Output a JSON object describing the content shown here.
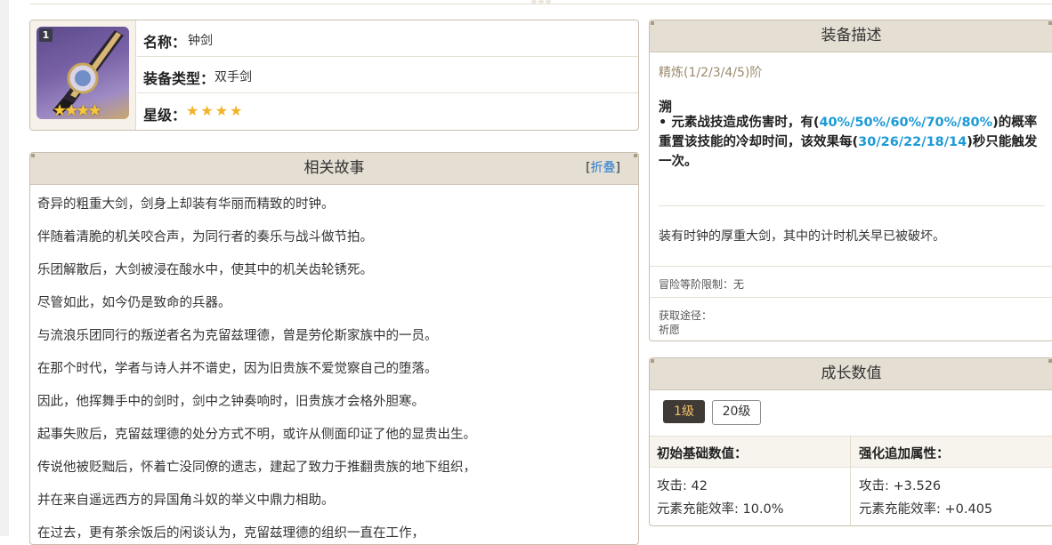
{
  "weapon": {
    "refinement_badge": "1",
    "portrait_stars": "★★★★",
    "name_label": "名称：",
    "name": "钟剑",
    "type_label": "装备类型：",
    "type": "双手剑",
    "rarity_label": "星级：",
    "rarity_stars": "★★★★",
    "rarity": 4
  },
  "story": {
    "title": "相关故事",
    "fold_open": "[",
    "fold_label": "折叠",
    "fold_close": "]",
    "lines": [
      "奇异的粗重大剑，剑身上却装有华丽而精致的时钟。",
      "伴随着清脆的机关咬合声，为同行者的奏乐与战斗做节拍。",
      "乐团解散后，大剑被浸在酸水中，使其中的机关齿轮锈死。",
      "尽管如此，如今仍是致命的兵器。",
      "与流浪乐团同行的叛逆者名为克留兹理德，曾是劳伦斯家族中的一员。",
      "在那个时代，学者与诗人并不谱史，因为旧贵族不爱觉察自己的堕落。",
      "因此，他挥舞手中的剑时，剑中之钟奏响时，旧贵族才会格外胆寒。",
      "起事失败后，克留兹理德的处分方式不明，或许从侧面印证了他的显贵出生。",
      "传说他被贬黜后，怀着亡没同僚的遗志，建起了致力于推翻贵族的地下组织，",
      "并在来自遥远西方的异国角斗奴的举义中鼎力相助。",
      "在过去，更有茶余饭后的闲谈认为，克留兹理德的组织一直在工作，"
    ]
  },
  "description": {
    "title": "装备描述",
    "refine": "精炼(1/2/3/4/5)阶",
    "passive_name": "溯",
    "passive_p1": "• 元素战技造成伤害时，有(",
    "passive_chance": "40%/50%/60%/70%/80%",
    "passive_p2": ")的概率重置该技能的冷却时间，该效果每(",
    "passive_cd": "30/26/22/18/14",
    "passive_p3": ")秒只能触发一次。",
    "flavor": "装有时钟的厚重大剑，其中的计时机关早已被破坏。",
    "level_limit": "冒险等阶限制：无",
    "source_label": "获取途径：",
    "source": "祈愿"
  },
  "growth": {
    "title": "成长数值",
    "levels": [
      "1级",
      "20级"
    ],
    "selected_level": "1级",
    "base_header": "初始基础数值：",
    "bonus_header": "强化追加属性：",
    "base_stats": [
      "攻击: 42",
      "元素充能效率: 10.0%"
    ],
    "bonus_stats": [
      "攻击: +3.526",
      "元素充能效率: +0.405"
    ]
  },
  "colors": {
    "panel_header": "#e5ded3",
    "border": "#c9bfae",
    "highlight_blue": "#1c9ad6",
    "star_gold": "#f2b225",
    "selected_tab_bg": "#3f3a36",
    "selected_tab_text": "#f5c067",
    "refine_text": "#9b8a6d"
  }
}
